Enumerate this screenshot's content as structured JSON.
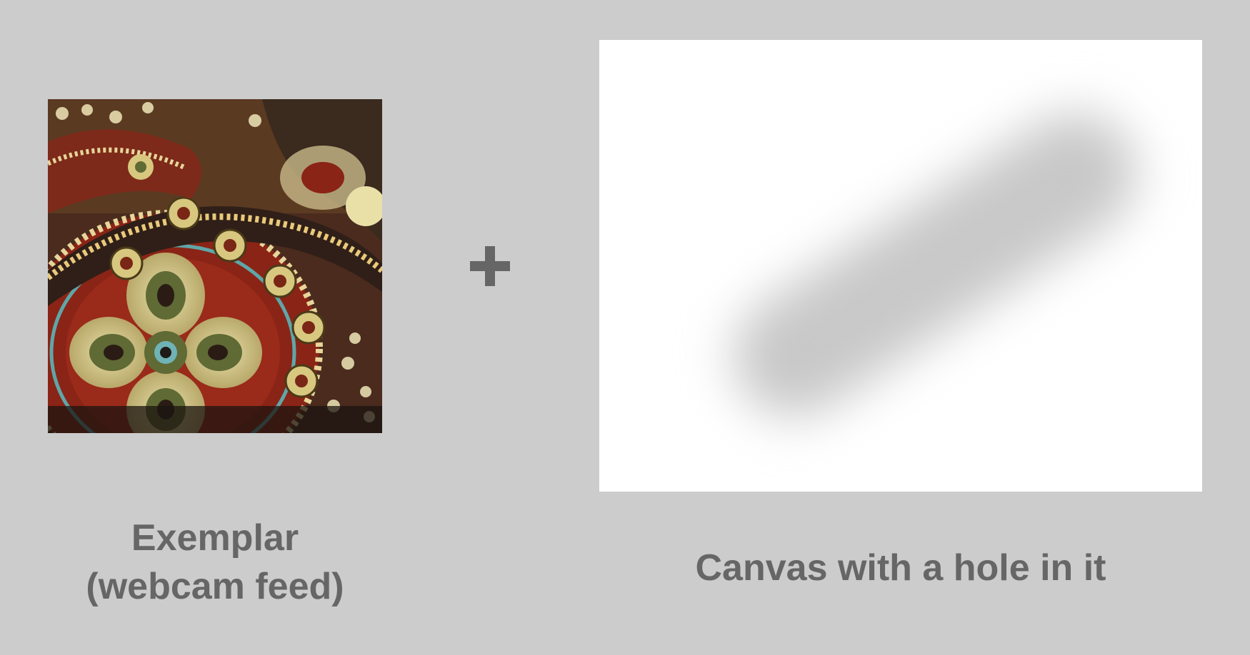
{
  "exemplar": {
    "line1": "Exemplar",
    "line2": "(webcam feed)",
    "image_description": "paisley-fabric-texture"
  },
  "operator": {
    "symbol": "plus-icon"
  },
  "canvas": {
    "label": "Canvas with a hole in it"
  },
  "colors": {
    "background": "#cccccc",
    "text": "#666666",
    "canvas_fill": "#ffffff",
    "hole": "#c8c8c8"
  }
}
